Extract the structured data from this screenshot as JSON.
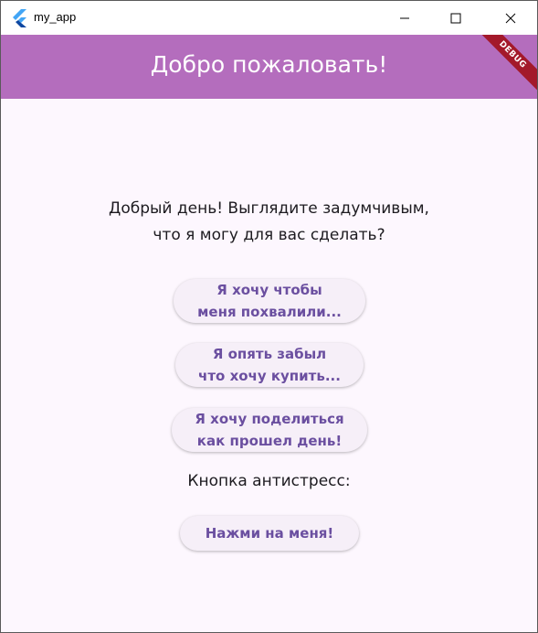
{
  "window": {
    "title": "my_app",
    "icon": "flutter-icon"
  },
  "appbar": {
    "title": "Добро пожаловать!",
    "background": "#b46dbd",
    "debug_label": "DEBUG"
  },
  "main": {
    "greeting_line1": "Добрый день! Выглядите задумчивым,",
    "greeting_line2": "что я могу для вас сделать?",
    "buttons": [
      {
        "line1": "Я хочу чтобы",
        "line2": "меня похвалили..."
      },
      {
        "line1": "Я опять забыл",
        "line2": "что хочу купить..."
      },
      {
        "line1": "Я хочу поделиться",
        "line2": "как прошел день!"
      }
    ],
    "antistress_label": "Кнопка антистресс:",
    "press_button": "Нажми на меня!"
  },
  "colors": {
    "background": "#fdf7fe",
    "button_text": "#6b4fa0",
    "button_bg": "#f6eff8"
  }
}
